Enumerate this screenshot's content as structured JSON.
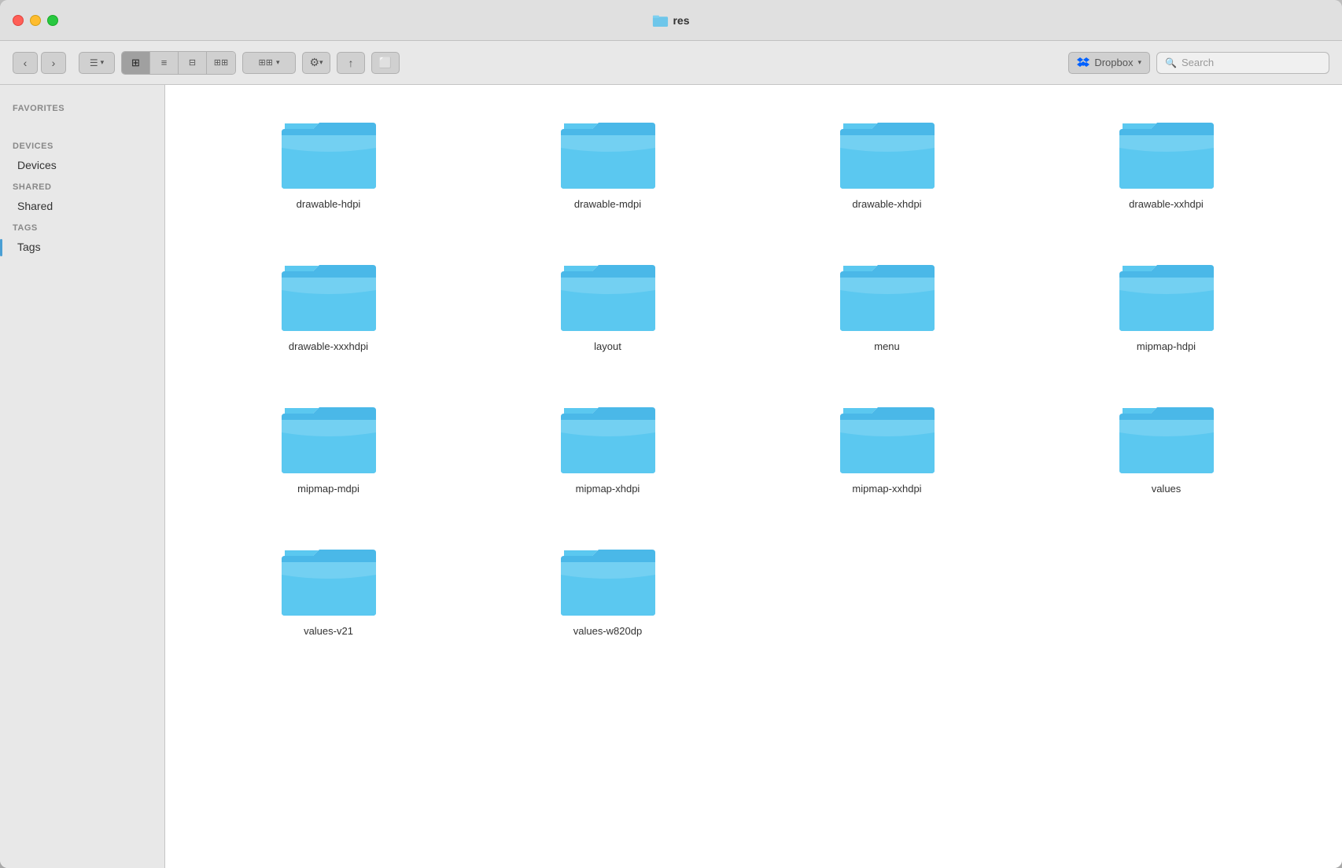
{
  "window": {
    "title": "res"
  },
  "titlebar": {
    "traffic_lights": {
      "close": "close",
      "minimize": "minimize",
      "maximize": "maximize"
    },
    "title": "res"
  },
  "toolbar": {
    "back_label": "‹",
    "forward_label": "›",
    "view_menu_label": "☰",
    "view_icon_grid": "⊞",
    "view_icon_list": "≡",
    "view_icon_column": "⊟",
    "view_icon_gallery": "⊞⊞",
    "group_label": "⊞⊞",
    "action_label": "⚙",
    "share_label": "↑",
    "tag_label": "⬜",
    "dropbox_label": "Dropbox",
    "search_placeholder": "Search"
  },
  "sidebar": {
    "sections": [
      {
        "label": "Favorites",
        "items": []
      },
      {
        "label": "Devices",
        "items": []
      },
      {
        "label": "Shared",
        "items": []
      },
      {
        "label": "Tags",
        "items": []
      }
    ]
  },
  "folders": [
    {
      "name": "drawable-hdpi"
    },
    {
      "name": "drawable-mdpi"
    },
    {
      "name": "drawable-xhdpi"
    },
    {
      "name": "drawable-xxhdpi"
    },
    {
      "name": "drawable-xxxhdpi"
    },
    {
      "name": "layout"
    },
    {
      "name": "menu"
    },
    {
      "name": "mipmap-hdpi"
    },
    {
      "name": "mipmap-mdpi"
    },
    {
      "name": "mipmap-xhdpi"
    },
    {
      "name": "mipmap-xxhdpi"
    },
    {
      "name": "values"
    },
    {
      "name": "values-v21"
    },
    {
      "name": "values-w820dp"
    }
  ],
  "colors": {
    "folder_light": "#6ec6ea",
    "folder_dark": "#4ab0e0",
    "folder_tab": "#7dd0f0"
  }
}
